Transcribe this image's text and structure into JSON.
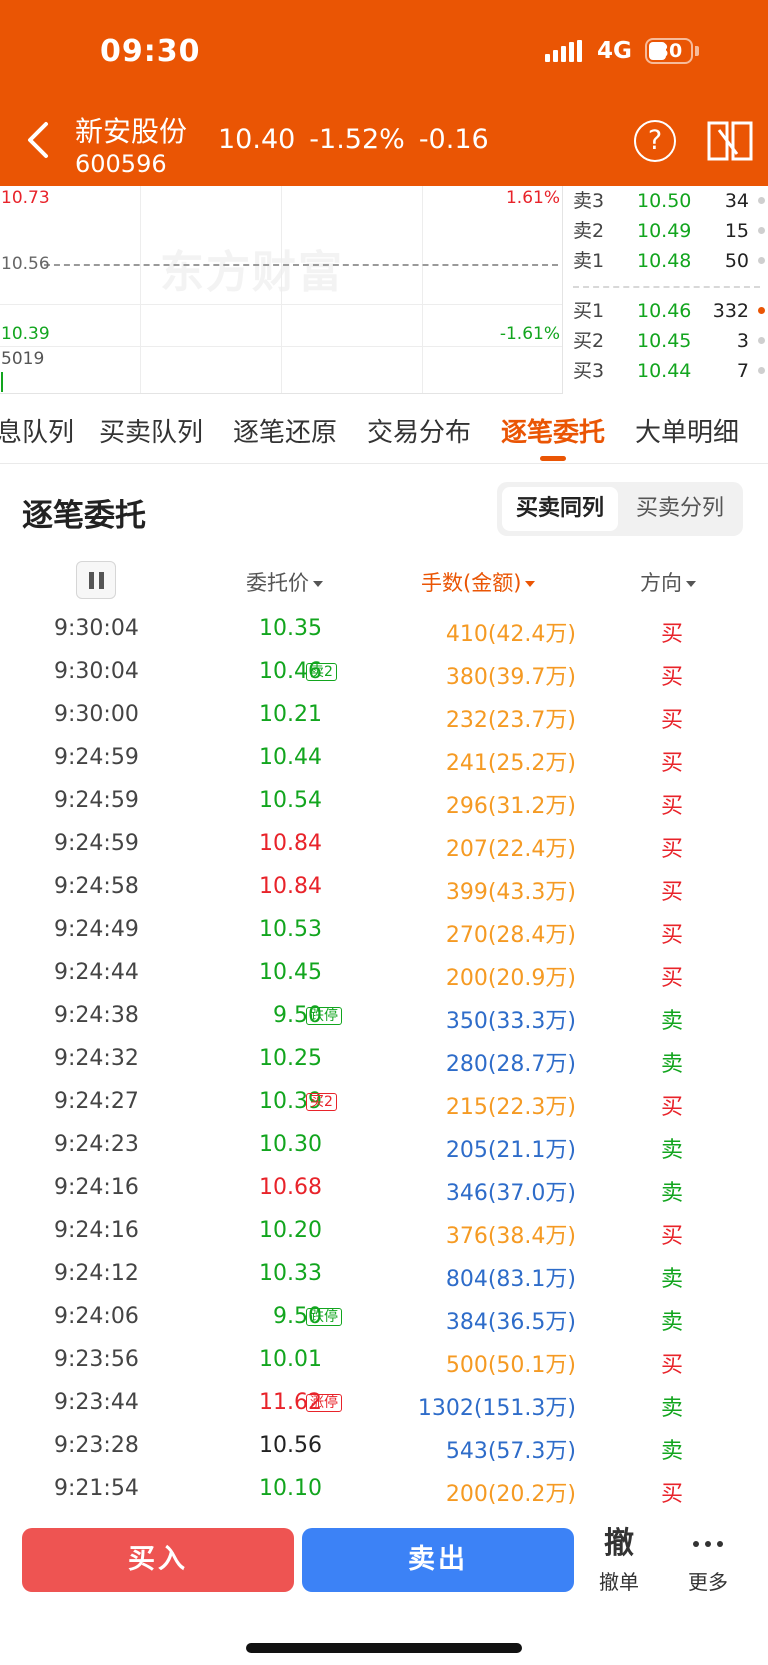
{
  "status": {
    "time": "09:30",
    "network": "4G",
    "battery": "30"
  },
  "header": {
    "stock_name": "新安股份",
    "stock_code": "600596",
    "price": "10.40",
    "change_pct": "-1.52%",
    "change": "-0.16",
    "help_icon": "?"
  },
  "chart": {
    "high": "10.73",
    "high_pct": "1.61%",
    "mid": "10.56",
    "low": "10.39",
    "low_pct": "-1.61%",
    "volume": "5019",
    "watermark": "东方财富"
  },
  "order_book": {
    "asks": [
      {
        "label": "卖3",
        "price": "10.50",
        "volume": "34"
      },
      {
        "label": "卖2",
        "price": "10.49",
        "volume": "15"
      },
      {
        "label": "卖1",
        "price": "10.48",
        "volume": "50"
      }
    ],
    "bids": [
      {
        "label": "买1",
        "price": "10.46",
        "volume": "332"
      },
      {
        "label": "买2",
        "price": "10.45",
        "volume": "3"
      },
      {
        "label": "买3",
        "price": "10.44",
        "volume": "7"
      }
    ]
  },
  "tabs": [
    "息队列",
    "买卖队列",
    "逐笔还原",
    "交易分布",
    "逐笔委托",
    "大单明细"
  ],
  "active_tab": "逐笔委托",
  "section": {
    "title": "逐笔委托",
    "seg_on": "买卖同列",
    "seg_off": "买卖分列"
  },
  "columns": {
    "price": "委托价",
    "qty": "手数(金额)",
    "direction": "方向"
  },
  "rows": [
    {
      "time": "9:30:04",
      "price": "10.35",
      "pc": "green",
      "tag": "",
      "qty": "410(42.4万)",
      "qc": "orange",
      "dir": "买"
    },
    {
      "time": "9:30:04",
      "price": "10.46",
      "pc": "green",
      "tag": "卖2",
      "tc": "green",
      "qty": "380(39.7万)",
      "qc": "orange",
      "dir": "买"
    },
    {
      "time": "9:30:00",
      "price": "10.21",
      "pc": "green",
      "tag": "",
      "qty": "232(23.7万)",
      "qc": "orange",
      "dir": "买"
    },
    {
      "time": "9:24:59",
      "price": "10.44",
      "pc": "green",
      "tag": "",
      "qty": "241(25.2万)",
      "qc": "orange",
      "dir": "买"
    },
    {
      "time": "9:24:59",
      "price": "10.54",
      "pc": "green",
      "tag": "",
      "qty": "296(31.2万)",
      "qc": "orange",
      "dir": "买"
    },
    {
      "time": "9:24:59",
      "price": "10.84",
      "pc": "red",
      "tag": "",
      "qty": "207(22.4万)",
      "qc": "orange",
      "dir": "买"
    },
    {
      "time": "9:24:58",
      "price": "10.84",
      "pc": "red",
      "tag": "",
      "qty": "399(43.3万)",
      "qc": "orange",
      "dir": "买"
    },
    {
      "time": "9:24:49",
      "price": "10.53",
      "pc": "green",
      "tag": "",
      "qty": "270(28.4万)",
      "qc": "orange",
      "dir": "买"
    },
    {
      "time": "9:24:44",
      "price": "10.45",
      "pc": "green",
      "tag": "",
      "qty": "200(20.9万)",
      "qc": "orange",
      "dir": "买"
    },
    {
      "time": "9:24:38",
      "price": "9.50",
      "pc": "green",
      "tag": "跌停",
      "tc": "green",
      "qty": "350(33.3万)",
      "qc": "blue",
      "dir": "卖"
    },
    {
      "time": "9:24:32",
      "price": "10.25",
      "pc": "green",
      "tag": "",
      "qty": "280(28.7万)",
      "qc": "blue",
      "dir": "卖"
    },
    {
      "time": "9:24:27",
      "price": "10.39",
      "pc": "green",
      "tag": "买2",
      "tc": "red",
      "qty": "215(22.3万)",
      "qc": "orange",
      "dir": "买"
    },
    {
      "time": "9:24:23",
      "price": "10.30",
      "pc": "green",
      "tag": "",
      "qty": "205(21.1万)",
      "qc": "blue",
      "dir": "卖"
    },
    {
      "time": "9:24:16",
      "price": "10.68",
      "pc": "red",
      "tag": "",
      "qty": "346(37.0万)",
      "qc": "blue",
      "dir": "卖"
    },
    {
      "time": "9:24:16",
      "price": "10.20",
      "pc": "green",
      "tag": "",
      "qty": "376(38.4万)",
      "qc": "orange",
      "dir": "买"
    },
    {
      "time": "9:24:12",
      "price": "10.33",
      "pc": "green",
      "tag": "",
      "qty": "804(83.1万)",
      "qc": "blue",
      "dir": "卖"
    },
    {
      "time": "9:24:06",
      "price": "9.50",
      "pc": "green",
      "tag": "跌停",
      "tc": "green",
      "qty": "384(36.5万)",
      "qc": "blue",
      "dir": "卖"
    },
    {
      "time": "9:23:56",
      "price": "10.01",
      "pc": "green",
      "tag": "",
      "qty": "500(50.1万)",
      "qc": "orange",
      "dir": "买"
    },
    {
      "time": "9:23:44",
      "price": "11.62",
      "pc": "red",
      "tag": "涨停",
      "tc": "red",
      "qty": "1302(151.3万)",
      "qc": "blue",
      "dir": "卖"
    },
    {
      "time": "9:23:28",
      "price": "10.56",
      "pc": "black",
      "tag": "",
      "qty": "543(57.3万)",
      "qc": "blue",
      "dir": "卖"
    },
    {
      "time": "9:21:54",
      "price": "10.10",
      "pc": "green",
      "tag": "",
      "qty": "200(20.2万)",
      "qc": "orange",
      "dir": "买"
    }
  ],
  "bottom": {
    "buy": "买入",
    "sell": "卖出",
    "cancel_icon": "撤",
    "cancel": "撤单",
    "more": "更多"
  },
  "colors": {
    "brand": "#ea5504",
    "up": "#e8232a",
    "down": "#12a51e",
    "buy_qty": "#f59a23",
    "sell_qty": "#2e6cc9"
  }
}
